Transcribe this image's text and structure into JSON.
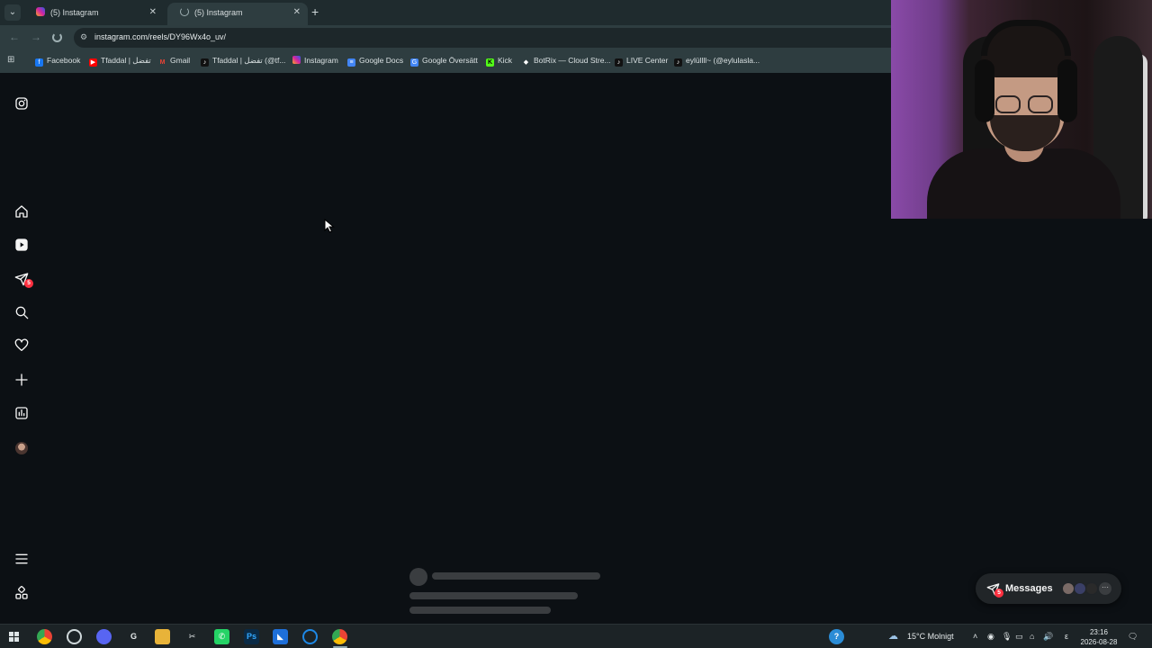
{
  "browser": {
    "tabs": [
      {
        "title": "(5) Instagram",
        "active": false
      },
      {
        "title": "(5) Instagram",
        "active": true
      }
    ],
    "new_tab": "+",
    "address": "instagram.com/reels/DY96Wx4o_uv/",
    "bookmarks": [
      {
        "label": "Facebook",
        "icon": "facebook-icon",
        "color": "#1877f2"
      },
      {
        "label": "Tfaddal | تفضل",
        "icon": "youtube-icon",
        "color": "#ff0000"
      },
      {
        "label": "Gmail",
        "icon": "gmail-icon",
        "color": "#ea4335"
      },
      {
        "label": "Tfaddal | تفضل (@tf...",
        "icon": "tiktok-icon",
        "color": "#111111"
      },
      {
        "label": "Instagram",
        "icon": "instagram-icon",
        "color": "#d6249f"
      },
      {
        "label": "Google Docs",
        "icon": "docs-icon",
        "color": "#4285f4"
      },
      {
        "label": "Google Översätt",
        "icon": "translate-icon",
        "color": "#4285f4"
      },
      {
        "label": "Kick",
        "icon": "kick-icon",
        "color": "#53fc18"
      },
      {
        "label": "BotRix — Cloud Stre...",
        "icon": "botrix-icon",
        "color": "#555555"
      },
      {
        "label": "LIVE Center",
        "icon": "tiktok-icon",
        "color": "#111111"
      },
      {
        "label": "eylüllll~ (@eylulasla...",
        "icon": "tiktok-icon",
        "color": "#111111"
      }
    ]
  },
  "sidebar": {
    "notification_count": "5",
    "items": [
      "instagram-logo-icon",
      "home-icon",
      "reels-icon",
      "messages-icon",
      "search-icon",
      "heart-icon",
      "create-icon",
      "insights-icon",
      "avatar",
      "menu-icon",
      "meta-apps-icon"
    ]
  },
  "messages": {
    "label": "Messages",
    "badge": "5",
    "more": "···"
  },
  "taskbar": {
    "weather": "15°C  Molnigt",
    "lang": "ε",
    "time": "23:16",
    "date": "2026-08-28",
    "notif_count": "5"
  },
  "colors": {
    "background": "#0c1014",
    "badge": "#ff3040",
    "chrome": "#2e3d40"
  }
}
